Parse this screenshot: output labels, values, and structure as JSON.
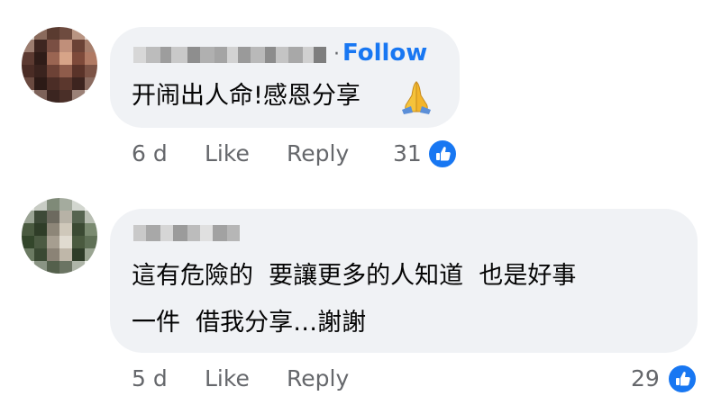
{
  "colors": {
    "accent": "#1877f2",
    "bubble": "#f0f2f5",
    "meta_text": "#65676b"
  },
  "comments": [
    {
      "author_redacted": true,
      "follow_label": "Follow",
      "text": "开闹出人命!感恩分享",
      "emoji_icon": "folded-hands-icon",
      "age": "6 d",
      "like_label": "Like",
      "reply_label": "Reply",
      "reaction_count": "31",
      "reaction_icon": "thumbs-up-icon"
    },
    {
      "author_redacted": true,
      "text_line1": "這有危險的  要讓更多的人知道  也是好事",
      "text_line2": "一件  借我分享…謝謝",
      "age": "5 d",
      "like_label": "Like",
      "reply_label": "Reply",
      "reaction_count": "29",
      "reaction_icon": "thumbs-up-icon"
    }
  ]
}
